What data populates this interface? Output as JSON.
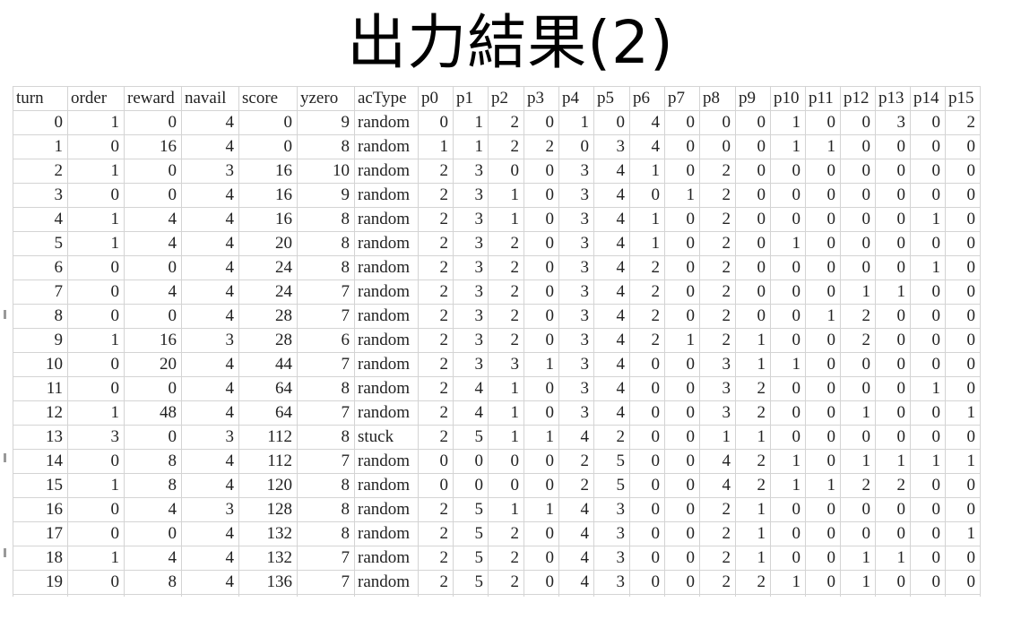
{
  "title": "出力結果(2)",
  "sheet": {
    "headers": [
      "turn",
      "order",
      "reward",
      "navail",
      "score",
      "yzero",
      "acType",
      "p0",
      "p1",
      "p2",
      "p3",
      "p4",
      "p5",
      "p6",
      "p7",
      "p8",
      "p9",
      "p10",
      "p11",
      "p12",
      "p13",
      "p14",
      "p15"
    ],
    "rows": [
      [
        "0",
        "1",
        "0",
        "4",
        "0",
        "9",
        "random",
        "0",
        "1",
        "2",
        "0",
        "1",
        "0",
        "4",
        "0",
        "0",
        "0",
        "1",
        "0",
        "0",
        "3",
        "0",
        "2"
      ],
      [
        "1",
        "0",
        "16",
        "4",
        "0",
        "8",
        "random",
        "1",
        "1",
        "2",
        "2",
        "0",
        "3",
        "4",
        "0",
        "0",
        "0",
        "1",
        "1",
        "0",
        "0",
        "0",
        "0"
      ],
      [
        "2",
        "1",
        "0",
        "3",
        "16",
        "10",
        "random",
        "2",
        "3",
        "0",
        "0",
        "3",
        "4",
        "1",
        "0",
        "2",
        "0",
        "0",
        "0",
        "0",
        "0",
        "0",
        "0"
      ],
      [
        "3",
        "0",
        "0",
        "4",
        "16",
        "9",
        "random",
        "2",
        "3",
        "1",
        "0",
        "3",
        "4",
        "0",
        "1",
        "2",
        "0",
        "0",
        "0",
        "0",
        "0",
        "0",
        "0"
      ],
      [
        "4",
        "1",
        "4",
        "4",
        "16",
        "8",
        "random",
        "2",
        "3",
        "1",
        "0",
        "3",
        "4",
        "1",
        "0",
        "2",
        "0",
        "0",
        "0",
        "0",
        "0",
        "1",
        "0"
      ],
      [
        "5",
        "1",
        "4",
        "4",
        "20",
        "8",
        "random",
        "2",
        "3",
        "2",
        "0",
        "3",
        "4",
        "1",
        "0",
        "2",
        "0",
        "1",
        "0",
        "0",
        "0",
        "0",
        "0"
      ],
      [
        "6",
        "0",
        "0",
        "4",
        "24",
        "8",
        "random",
        "2",
        "3",
        "2",
        "0",
        "3",
        "4",
        "2",
        "0",
        "2",
        "0",
        "0",
        "0",
        "0",
        "0",
        "1",
        "0"
      ],
      [
        "7",
        "0",
        "4",
        "4",
        "24",
        "7",
        "random",
        "2",
        "3",
        "2",
        "0",
        "3",
        "4",
        "2",
        "0",
        "2",
        "0",
        "0",
        "0",
        "1",
        "1",
        "0",
        "0"
      ],
      [
        "8",
        "0",
        "0",
        "4",
        "28",
        "7",
        "random",
        "2",
        "3",
        "2",
        "0",
        "3",
        "4",
        "2",
        "0",
        "2",
        "0",
        "0",
        "1",
        "2",
        "0",
        "0",
        "0"
      ],
      [
        "9",
        "1",
        "16",
        "3",
        "28",
        "6",
        "random",
        "2",
        "3",
        "2",
        "0",
        "3",
        "4",
        "2",
        "1",
        "2",
        "1",
        "0",
        "0",
        "2",
        "0",
        "0",
        "0"
      ],
      [
        "10",
        "0",
        "20",
        "4",
        "44",
        "7",
        "random",
        "2",
        "3",
        "3",
        "1",
        "3",
        "4",
        "0",
        "0",
        "3",
        "1",
        "1",
        "0",
        "0",
        "0",
        "0",
        "0"
      ],
      [
        "11",
        "0",
        "0",
        "4",
        "64",
        "8",
        "random",
        "2",
        "4",
        "1",
        "0",
        "3",
        "4",
        "0",
        "0",
        "3",
        "2",
        "0",
        "0",
        "0",
        "0",
        "1",
        "0"
      ],
      [
        "12",
        "1",
        "48",
        "4",
        "64",
        "7",
        "random",
        "2",
        "4",
        "1",
        "0",
        "3",
        "4",
        "0",
        "0",
        "3",
        "2",
        "0",
        "0",
        "1",
        "0",
        "0",
        "1"
      ],
      [
        "13",
        "3",
        "0",
        "3",
        "112",
        "8",
        "stuck",
        "2",
        "5",
        "1",
        "1",
        "4",
        "2",
        "0",
        "0",
        "1",
        "1",
        "0",
        "0",
        "0",
        "0",
        "0",
        "0"
      ],
      [
        "14",
        "0",
        "8",
        "4",
        "112",
        "7",
        "random",
        "0",
        "0",
        "0",
        "0",
        "2",
        "5",
        "0",
        "0",
        "4",
        "2",
        "1",
        "0",
        "1",
        "1",
        "1",
        "1"
      ],
      [
        "15",
        "1",
        "8",
        "4",
        "120",
        "8",
        "random",
        "0",
        "0",
        "0",
        "0",
        "2",
        "5",
        "0",
        "0",
        "4",
        "2",
        "1",
        "1",
        "2",
        "2",
        "0",
        "0"
      ],
      [
        "16",
        "0",
        "4",
        "3",
        "128",
        "8",
        "random",
        "2",
        "5",
        "1",
        "1",
        "4",
        "3",
        "0",
        "0",
        "2",
        "1",
        "0",
        "0",
        "0",
        "0",
        "0",
        "0"
      ],
      [
        "17",
        "0",
        "0",
        "4",
        "132",
        "8",
        "random",
        "2",
        "5",
        "2",
        "0",
        "4",
        "3",
        "0",
        "0",
        "2",
        "1",
        "0",
        "0",
        "0",
        "0",
        "0",
        "1"
      ],
      [
        "18",
        "1",
        "4",
        "4",
        "132",
        "7",
        "random",
        "2",
        "5",
        "2",
        "0",
        "4",
        "3",
        "0",
        "0",
        "2",
        "1",
        "0",
        "0",
        "1",
        "1",
        "0",
        "0"
      ],
      [
        "19",
        "0",
        "8",
        "4",
        "136",
        "7",
        "random",
        "2",
        "5",
        "2",
        "0",
        "4",
        "3",
        "0",
        "0",
        "2",
        "2",
        "1",
        "0",
        "1",
        "0",
        "0",
        "0"
      ]
    ]
  }
}
